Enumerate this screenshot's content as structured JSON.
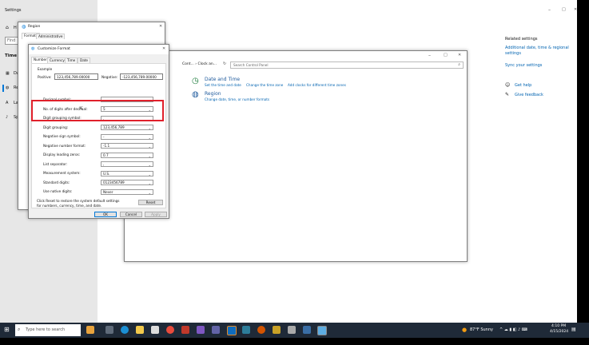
{
  "settings": {
    "title": "Settings",
    "nav_home": "H",
    "search_placeholder": "Find",
    "section": "Time &",
    "nav_date": "Da",
    "nav_region": "Re",
    "nav_language": "La",
    "nav_speech": "Sp",
    "related_title": "Related settings",
    "related_link1": "Additional date, time & regional settings",
    "related_link2": "Sync your settings",
    "help_link": "Get help",
    "feedback_link": "Give feedback"
  },
  "region_window": {
    "title": "Region",
    "tab_formats": "Formats",
    "tab_admin": "Administrative"
  },
  "control_panel": {
    "breadcrumb": "Cont... › Clock an...",
    "search_placeholder": "Search Control Panel",
    "cat1_title": "Date and Time",
    "cat1_links": [
      "Set the time and date",
      "Change the time zone",
      "Add clocks for different time zones"
    ],
    "cat2_title": "Region",
    "cat2_links": [
      "Change date, time, or number formats"
    ]
  },
  "customize_format": {
    "title": "Customize Format",
    "tabs": [
      "Numbers",
      "Currency",
      "Time",
      "Date"
    ],
    "example_label": "Example",
    "positive_label": "Positive:",
    "positive_value": "123,456,789.00000",
    "negative_label": "Negative:",
    "negative_value": "-123,456,789.00000",
    "rows": [
      {
        "label": "Decimal symbol:",
        "value": "."
      },
      {
        "label": "No. of digits after decimal:",
        "value": "5"
      },
      {
        "label": "Digit grouping symbol:",
        "value": ","
      },
      {
        "label": "Digit grouping:",
        "value": "123,456,789"
      },
      {
        "label": "Negative sign symbol:",
        "value": "-"
      },
      {
        "label": "Negative number format:",
        "value": "-1.1"
      },
      {
        "label": "Display leading zeros:",
        "value": "0.7"
      },
      {
        "label": "List separator:",
        "value": ","
      },
      {
        "label": "Measurement system:",
        "value": "U.S."
      },
      {
        "label": "Standard digits:",
        "value": "0123456789"
      },
      {
        "label": "Use native digits:",
        "value": "Never"
      }
    ],
    "reset_note": "Click Reset to restore the system default settings for numbers, currency, time, and date.",
    "reset_button": "Reset",
    "ok_button": "OK",
    "cancel_button": "Cancel",
    "apply_button": "Apply"
  },
  "taskbar": {
    "search_placeholder": "Type here to search",
    "weather": "87°F Sunny",
    "time": "4:10 PM",
    "date": "4/15/2024"
  }
}
